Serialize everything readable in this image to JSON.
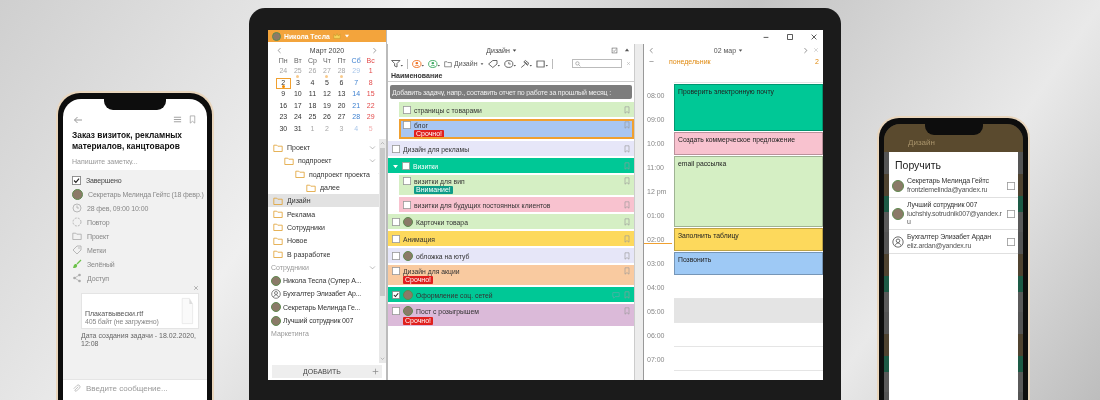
{
  "left_phone": {
    "title": "Заказ визиток, рекламных материалов, канцтоваров",
    "note_placeholder": "Напишите заметку...",
    "fields": [
      {
        "kind": "checkbox",
        "label": "Завершено",
        "checked": true
      },
      {
        "kind": "person",
        "label": "Секретарь Мелинда Гейтс (18 февр.)"
      },
      {
        "kind": "time",
        "label": "28 фев, 09:00 10:00"
      },
      {
        "kind": "repeat",
        "label": "Повтор"
      },
      {
        "kind": "project",
        "label": "Проект"
      },
      {
        "kind": "tags",
        "label": "Метки"
      },
      {
        "kind": "color",
        "label": "Зелёный"
      },
      {
        "kind": "share",
        "label": "Доступ"
      }
    ],
    "attachment": {
      "file_name": "Плакатвывески.rtf",
      "file_size": "405 байт (не загружено)"
    },
    "created_note": "Дата создания задачи - 18.02.2020, 12:08",
    "message_placeholder": "Введите сообщение..."
  },
  "laptop": {
    "user_name": "Никола Тесла",
    "calendar": {
      "month": "Март 2020",
      "weekdays": [
        "Пн",
        "Вт",
        "Ср",
        "Чт",
        "Пт",
        "Сб",
        "Вс"
      ],
      "weeks": [
        [
          {
            "d": "24",
            "muted": true,
            "dot": false,
            "selected": false
          },
          {
            "d": "25",
            "muted": true,
            "dot": true,
            "selected": false
          },
          {
            "d": "26",
            "muted": true,
            "dot": false,
            "selected": false
          },
          {
            "d": "27",
            "muted": true,
            "dot": true,
            "selected": false
          },
          {
            "d": "28",
            "muted": true,
            "dot": true,
            "selected": false
          },
          {
            "d": "29",
            "muted": true,
            "dot": false,
            "selected": false
          },
          {
            "d": "1",
            "muted": false,
            "dot": false,
            "selected": false
          }
        ],
        [
          {
            "d": "2",
            "muted": false,
            "dot": true,
            "selected": true
          },
          {
            "d": "3",
            "muted": false,
            "dot": false,
            "selected": false
          },
          {
            "d": "4",
            "muted": false,
            "dot": false,
            "selected": false
          },
          {
            "d": "5",
            "muted": false,
            "dot": false,
            "selected": false
          },
          {
            "d": "6",
            "muted": false,
            "dot": false,
            "selected": false
          },
          {
            "d": "7",
            "muted": false,
            "dot": false,
            "selected": false
          },
          {
            "d": "8",
            "muted": false,
            "dot": false,
            "selected": false
          }
        ],
        [
          {
            "d": "9",
            "muted": false,
            "dot": false,
            "selected": false
          },
          {
            "d": "10",
            "muted": false,
            "dot": false,
            "selected": false
          },
          {
            "d": "11",
            "muted": false,
            "dot": false,
            "selected": false
          },
          {
            "d": "12",
            "muted": false,
            "dot": false,
            "selected": false
          },
          {
            "d": "13",
            "muted": false,
            "dot": false,
            "selected": false
          },
          {
            "d": "14",
            "muted": false,
            "dot": false,
            "selected": false
          },
          {
            "d": "15",
            "muted": false,
            "dot": false,
            "selected": false
          }
        ],
        [
          {
            "d": "16",
            "muted": false,
            "dot": false,
            "selected": false
          },
          {
            "d": "17",
            "muted": false,
            "dot": false,
            "selected": false
          },
          {
            "d": "18",
            "muted": false,
            "dot": false,
            "selected": false
          },
          {
            "d": "19",
            "muted": false,
            "dot": false,
            "selected": false
          },
          {
            "d": "20",
            "muted": false,
            "dot": false,
            "selected": false
          },
          {
            "d": "21",
            "muted": false,
            "dot": false,
            "selected": false
          },
          {
            "d": "22",
            "muted": false,
            "dot": false,
            "selected": false
          }
        ],
        [
          {
            "d": "23",
            "muted": false,
            "dot": false,
            "selected": false
          },
          {
            "d": "24",
            "muted": false,
            "dot": false,
            "selected": false
          },
          {
            "d": "25",
            "muted": false,
            "dot": false,
            "selected": false
          },
          {
            "d": "26",
            "muted": false,
            "dot": false,
            "selected": false
          },
          {
            "d": "27",
            "muted": false,
            "dot": false,
            "selected": false
          },
          {
            "d": "28",
            "muted": false,
            "dot": false,
            "selected": false
          },
          {
            "d": "29",
            "muted": false,
            "dot": false,
            "selected": false
          }
        ],
        [
          {
            "d": "30",
            "muted": false,
            "dot": false,
            "selected": false
          },
          {
            "d": "31",
            "muted": false,
            "dot": false,
            "selected": false
          },
          {
            "d": "1",
            "muted": true,
            "dot": false,
            "selected": false
          },
          {
            "d": "2",
            "muted": true,
            "dot": false,
            "selected": false
          },
          {
            "d": "3",
            "muted": true,
            "dot": false,
            "selected": false
          },
          {
            "d": "4",
            "muted": true,
            "dot": false,
            "selected": false
          },
          {
            "d": "5",
            "muted": true,
            "dot": false,
            "selected": false
          }
        ]
      ]
    },
    "folders": [
      {
        "label": "Проект",
        "expanded": true,
        "selected": false,
        "children": [
          {
            "label": "подпроект",
            "expanded": true,
            "selected": false,
            "children": [
              {
                "label": "подпроект проекта",
                "expanded": true,
                "selected": false,
                "children": [
                  {
                    "label": "далее",
                    "selected": false
                  }
                ]
              }
            ]
          }
        ]
      },
      {
        "label": "Дизайн",
        "selected": true
      },
      {
        "label": "Реклама",
        "selected": false
      },
      {
        "label": "Сотрудники",
        "selected": false
      },
      {
        "label": "Новое",
        "selected": false
      },
      {
        "label": "В разработке",
        "selected": false
      }
    ],
    "people_section": {
      "title": "Сотрудники",
      "expanded": true
    },
    "people": [
      {
        "name": "Никола Тесла (Супер А...",
        "kind": "photo"
      },
      {
        "name": "Бухгалтер Элизабет Ар...",
        "kind": "silhouette"
      },
      {
        "name": "Секретарь Мелинда Ге...",
        "kind": "photo"
      },
      {
        "name": "Лучший сотрудник 007",
        "kind": "photo"
      }
    ],
    "marketing_section": "Маркетинга",
    "add_button": "ДОБАВИТЬ",
    "task_list": {
      "title": "Дизайн",
      "filter_project": "Дизайн",
      "column": "Наименование",
      "add_placeholder": "Добавить задачу, напр., составить отчет по работе за прошлый месяц :",
      "tasks": [
        {
          "children": [
            {
              "label": "страницы с товарами",
              "color": "#d5efc4",
              "checked": false,
              "selected": false
            },
            {
              "label": "блог",
              "color": "#a9c6f2",
              "checked": false,
              "selected": true,
              "badge": {
                "kind": "urgent",
                "text": "Срочно!"
              }
            }
          ]
        },
        {
          "label": "Дизайн для рекламы",
          "color": "#e6e6f8",
          "checked": false,
          "selected": false
        },
        {
          "label": "Визитки",
          "color": "#00c896",
          "checked": false,
          "selected": false,
          "expanded": true,
          "children": [
            {
              "label": "визитки для вип",
              "color": "#d5efc4",
              "checked": false,
              "selected": false,
              "badge": {
                "kind": "attention",
                "text": "Внимание!"
              }
            },
            {
              "label": "визитки для будущих постоянных клиентов",
              "color": "#f8c2cf",
              "checked": false,
              "selected": false
            }
          ]
        },
        {
          "label": "Карточки товара",
          "color": "#d5efc4",
          "checked": false,
          "selected": false,
          "avatar": true
        },
        {
          "label": "Анимация",
          "color": "#fdd95c",
          "checked": false,
          "selected": false
        },
        {
          "label": "обложка на ютуб",
          "color": "#e6e6f8",
          "checked": false,
          "selected": false,
          "avatar": true
        },
        {
          "label": "Дизайн для акции",
          "color": "#f9caa0",
          "checked": false,
          "selected": false,
          "badge": {
            "kind": "urgent",
            "text": "Срочно!"
          }
        },
        {
          "label": "Оформление соц. сетей",
          "color": "#00c896",
          "checked": true,
          "selected": false,
          "avatar": true,
          "comment": true
        },
        {
          "label": "Пост с розыгрышем",
          "color": "#dbbad9",
          "checked": false,
          "selected": false,
          "avatar": true,
          "badge": {
            "kind": "urgent",
            "text": "Срочно!"
          }
        }
      ]
    },
    "day_view": {
      "date": "02 мар",
      "weekday": "понедельник",
      "day_number": "2",
      "hours": [
        {
          "label": "08:00",
          "now": false,
          "continues": false,
          "event": {
            "title": "Проверить электронную почту",
            "color": "#00c896"
          }
        },
        {
          "label": "09:00",
          "now": false,
          "continues": true
        },
        {
          "label": "10:00",
          "now": false,
          "continues": false,
          "event": {
            "title": "Создать коммерческое предложение",
            "color": "#f8c2cf"
          }
        },
        {
          "label": "11:00",
          "now": false,
          "continues": false,
          "event": {
            "title": "email рассылка",
            "color": "#d5efc4"
          }
        },
        {
          "label": "12 pm",
          "now": false,
          "continues": true
        },
        {
          "label": "01:00",
          "now": false,
          "continues": true
        },
        {
          "label": "02:00",
          "now": true,
          "continues": false,
          "event": {
            "title": "Заполнить таблицу",
            "color": "#fdd95c"
          }
        },
        {
          "label": "03:00",
          "now": false,
          "continues": false,
          "event": {
            "title": "Позвонить",
            "color": "#9ec9f5"
          }
        },
        {
          "label": "04:00",
          "now": false,
          "continues": false,
          "shaded": false
        },
        {
          "label": "05:00",
          "now": false,
          "continues": false,
          "shaded": true
        },
        {
          "label": "06:00",
          "now": false,
          "continues": false,
          "shaded": false
        },
        {
          "label": "07:00",
          "now": false,
          "continues": false,
          "shaded": false
        }
      ]
    }
  },
  "right_phone": {
    "background_title": "Дизайн",
    "title": "Поручить",
    "people": [
      {
        "name": "Секретарь Мелинда Гейтс",
        "email": "frontzlemelinda@yandex.ru",
        "kind": "photo",
        "checked": false
      },
      {
        "name": "Лучший сотрудник 007",
        "email": "luchshiy.sotrudnik007@yandex.ru",
        "kind": "photo",
        "checked": false
      },
      {
        "name": "Бухгалтер Элизабет Ардан",
        "email": "eliz.ardan@yandex.ru",
        "kind": "silhouette",
        "checked": false
      }
    ]
  }
}
